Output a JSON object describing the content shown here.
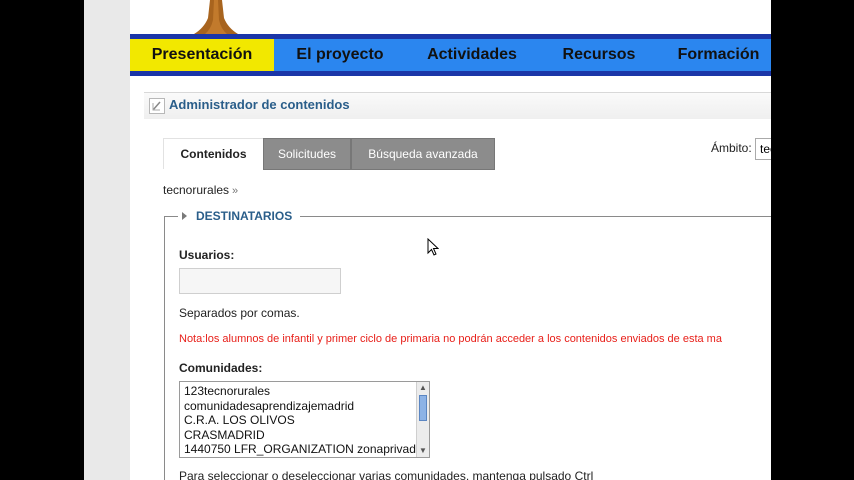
{
  "nav": {
    "items": [
      {
        "label": "Presentación",
        "active": true
      },
      {
        "label": "El proyecto",
        "active": false
      },
      {
        "label": "Actividades",
        "active": false
      },
      {
        "label": "Recursos",
        "active": false
      },
      {
        "label": "Formación",
        "active": false
      }
    ],
    "colors": {
      "bar": "#2b86ef",
      "border": "#1b36a8",
      "active": "#f2e800"
    }
  },
  "panel": {
    "title": "Administrador de contenidos",
    "icon": "document-icon"
  },
  "tabs": [
    {
      "label": "Contenidos",
      "selected": true
    },
    {
      "label": "Solicitudes",
      "selected": false
    },
    {
      "label": "Búsqueda avanzada",
      "selected": false
    }
  ],
  "scope": {
    "label": "Ámbito:",
    "value": "tec"
  },
  "breadcrumb": {
    "text": "tecnorurales",
    "separator": "»"
  },
  "section": {
    "title": "DESTINATARIOS"
  },
  "form": {
    "users_label": "Usuarios:",
    "users_value": "",
    "users_hint": "Separados por comas.",
    "note": "Nota:los alumnos de infantil y primer ciclo de primaria no podrán acceder a los contenidos enviados de esta ma",
    "communities_label": "Comunidades:",
    "communities": [
      "123tecnorurales",
      "comunidadesaprendizajemadrid",
      "C.R.A. LOS OLIVOS",
      "CRASMADRID",
      "1440750 LFR_ORGANIZATION zonaprivad"
    ],
    "communities_hint": "Para seleccionar o deseleccionar varias comunidades, mantenga pulsado Ctrl"
  }
}
